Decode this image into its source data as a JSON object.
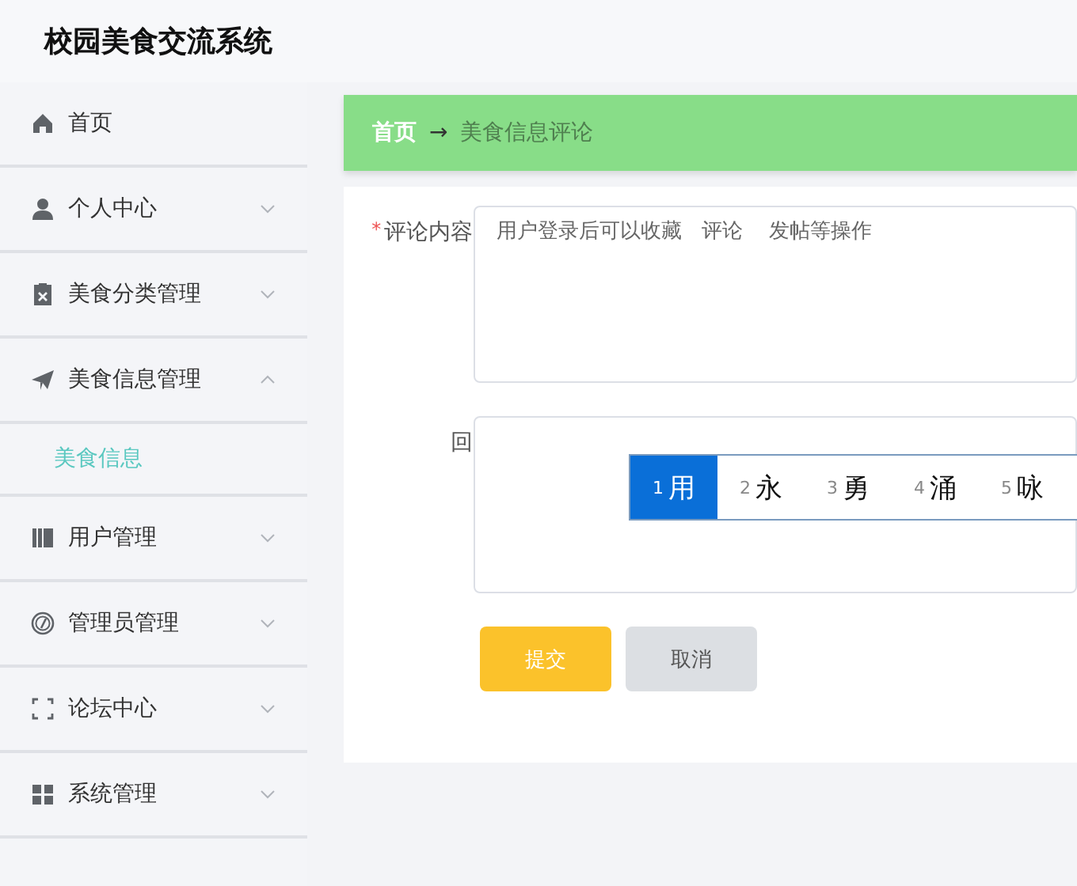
{
  "app": {
    "title": "校园美食交流系统"
  },
  "sidebar": {
    "items": [
      {
        "kind": "link",
        "label": "首页"
      },
      {
        "kind": "menu",
        "label": "个人中心",
        "expanded": false
      },
      {
        "kind": "menu",
        "label": "美食分类管理",
        "expanded": false
      },
      {
        "kind": "menu",
        "label": "美食信息管理",
        "expanded": true,
        "children": [
          {
            "label": "美食信息",
            "selected": true
          }
        ]
      },
      {
        "kind": "menu",
        "label": "用户管理",
        "expanded": false
      },
      {
        "kind": "menu",
        "label": "管理员管理",
        "expanded": false
      },
      {
        "kind": "menu",
        "label": "论坛中心",
        "expanded": false
      },
      {
        "kind": "menu",
        "label": "系统管理",
        "expanded": false
      }
    ]
  },
  "breadcrumb": {
    "items": [
      {
        "label": "首页",
        "current": false
      },
      {
        "label": "美食信息评论",
        "current": true
      }
    ],
    "separator": "→"
  },
  "form": {
    "fields": [
      {
        "label": "评论内容",
        "required_mark": "*",
        "value": "用户登录后可以收藏   评论    发帖等操作"
      },
      {
        "label": "回"
      }
    ],
    "buttons": [
      {
        "label": "提交",
        "kind": "primary"
      },
      {
        "label": "取消",
        "kind": "secondary"
      }
    ]
  },
  "ime": {
    "candidates": [
      {
        "index": "1",
        "text": "用",
        "selected": true
      },
      {
        "index": "2",
        "text": "永",
        "selected": false
      },
      {
        "index": "3",
        "text": "勇",
        "selected": false
      },
      {
        "index": "4",
        "text": "涌",
        "selected": false
      },
      {
        "index": "5",
        "text": "咏",
        "selected": false
      }
    ]
  }
}
